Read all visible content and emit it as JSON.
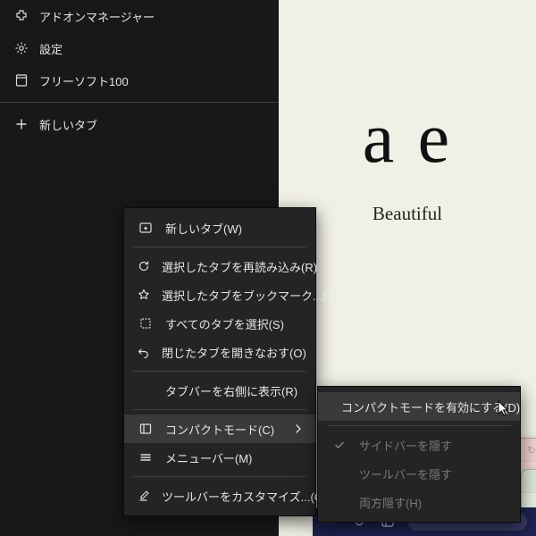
{
  "sidebar": {
    "items": [
      {
        "label": "アドオンマネージャー",
        "icon": "puzzle-icon"
      },
      {
        "label": "設定",
        "icon": "gear-icon"
      },
      {
        "label": "フリーソフト100",
        "icon": "page-icon"
      },
      {
        "label": "新しいタブ",
        "icon": "plus-icon"
      }
    ]
  },
  "context_menu": {
    "items": [
      {
        "label": "新しいタブ(W)",
        "icon": "new-tab-icon"
      },
      {
        "label": "選択したタブを再読み込み(R)",
        "icon": "reload-icon"
      },
      {
        "label": "選択したタブをブックマーク...(T)",
        "icon": "star-icon"
      },
      {
        "label": "すべてのタブを選択(S)",
        "icon": "select-all-icon"
      },
      {
        "label": "閉じたタブを開きなおす(O)",
        "icon": "undo-icon"
      },
      {
        "label": "タブバーを右側に表示(R)"
      },
      {
        "label": "コンパクトモード(C)",
        "icon": "layout-icon",
        "submenu": true,
        "selected": true
      },
      {
        "label": "メニューバー(M)",
        "icon": "menu-icon"
      },
      {
        "label": "ツールバーをカスタマイズ...(C)",
        "icon": "brush-icon"
      }
    ]
  },
  "submenu": {
    "items": [
      {
        "label": "コンパクトモードを有効にする(D)",
        "selected": true
      },
      {
        "label": "サイドバーを隠す",
        "icon": "check-icon",
        "disabled": true
      },
      {
        "label": "ツールバーを隠す",
        "disabled": true
      },
      {
        "label": "両方隠す(H)",
        "disabled": true
      }
    ]
  },
  "content": {
    "headline": "a e",
    "tagline": "Beautiful"
  },
  "colors": {
    "sidebar_bg": "#181818",
    "menu_bg": "#242424",
    "content_bg": "#f1f0e6",
    "toolbar_bg": "#1d2250"
  }
}
